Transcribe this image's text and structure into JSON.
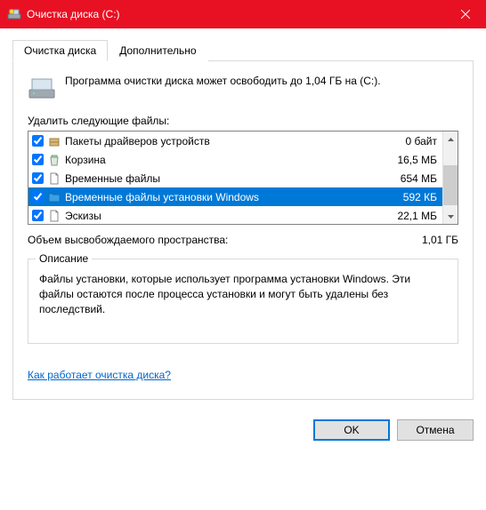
{
  "titlebar": {
    "text": "Очистка диска  (C:)"
  },
  "tabs": {
    "active": "Очистка диска",
    "other": "Дополнительно"
  },
  "summary": "Программа очистки диска может освободить до 1,04 ГБ на (C:).",
  "delete_label": "Удалить следующие файлы:",
  "files": [
    {
      "name": "Пакеты драйверов устройств",
      "size": "0 байт",
      "checked": true,
      "icon": "package"
    },
    {
      "name": "Корзина",
      "size": "16,5 МБ",
      "checked": true,
      "icon": "recycle"
    },
    {
      "name": "Временные файлы",
      "size": "654 МБ",
      "checked": true,
      "icon": "file"
    },
    {
      "name": "Временные файлы установки Windows",
      "size": "592 КБ",
      "checked": true,
      "icon": "folder-blue",
      "selected": true
    },
    {
      "name": "Эскизы",
      "size": "22,1 МБ",
      "checked": true,
      "icon": "file"
    }
  ],
  "freed": {
    "label": "Объем высвобождаемого пространства:",
    "value": "1,01 ГБ"
  },
  "description": {
    "legend": "Описание",
    "text": "Файлы установки, которые использует программа установки Windows.  Эти файлы остаются после процесса установки и могут быть удалены без последствий."
  },
  "help_link": "Как работает очистка диска?",
  "buttons": {
    "ok": "OK",
    "cancel": "Отмена"
  }
}
